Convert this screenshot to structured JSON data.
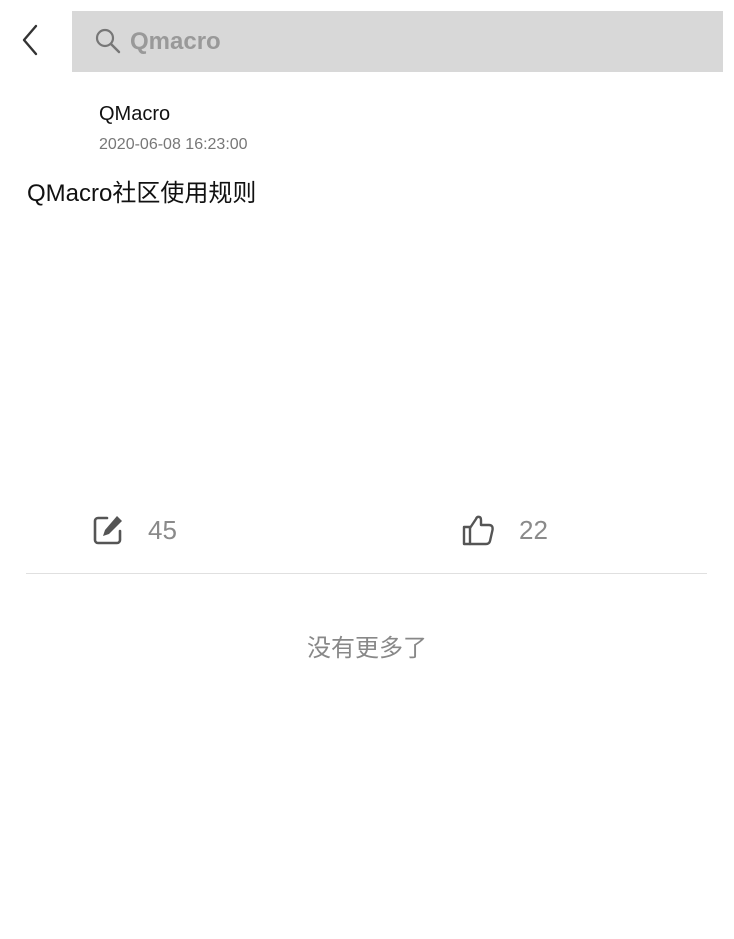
{
  "header": {
    "back_icon": "chevron-left-icon",
    "search_icon": "search-icon",
    "search_text": "Qmacro"
  },
  "post": {
    "author": "QMacro",
    "timestamp": "2020-06-08 16:23:00",
    "title": "QMacro社区使用规则"
  },
  "actions": {
    "comment_icon": "edit-icon",
    "comment_count": "45",
    "like_icon": "thumbs-up-icon",
    "like_count": "22"
  },
  "footer": {
    "no_more_text": "没有更多了"
  },
  "colors": {
    "search_bg": "#d8d8d8",
    "muted_text": "#888888"
  }
}
